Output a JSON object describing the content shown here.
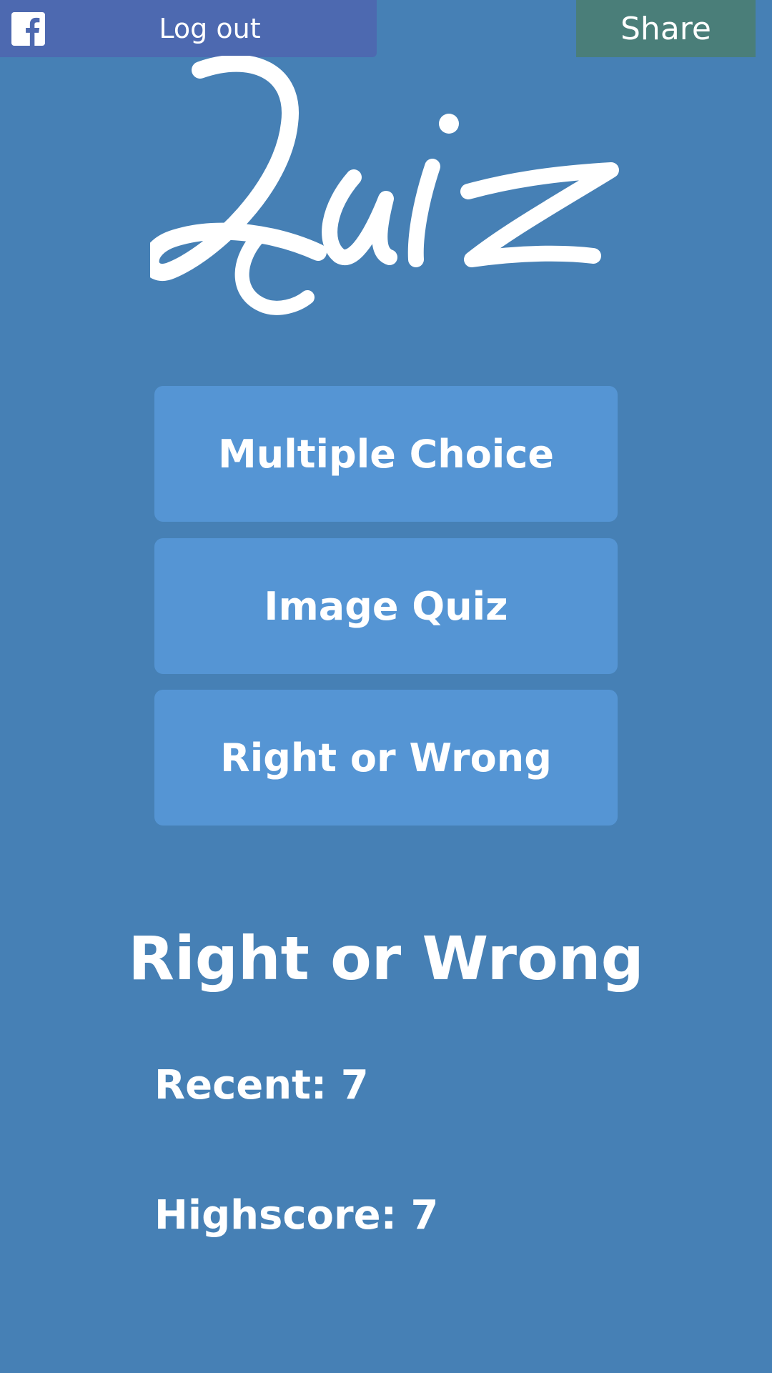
{
  "topbar": {
    "facebook": {
      "icon": "facebook-icon",
      "label": "Log out"
    },
    "share": {
      "label": "Share"
    }
  },
  "logo": {
    "text": "Quiz"
  },
  "menu": {
    "items": [
      {
        "label": "Multiple Choice"
      },
      {
        "label": "Image Quiz"
      },
      {
        "label": "Right or Wrong"
      }
    ]
  },
  "scores": {
    "title": "Right or Wrong",
    "recent": "Recent: 7",
    "highscore": "Highscore: 7"
  },
  "colors": {
    "background": "#4680b5",
    "facebook_button": "#4d69b0",
    "share_button": "#4a7e79",
    "menu_button": "#5595d4",
    "text": "#ffffff"
  }
}
